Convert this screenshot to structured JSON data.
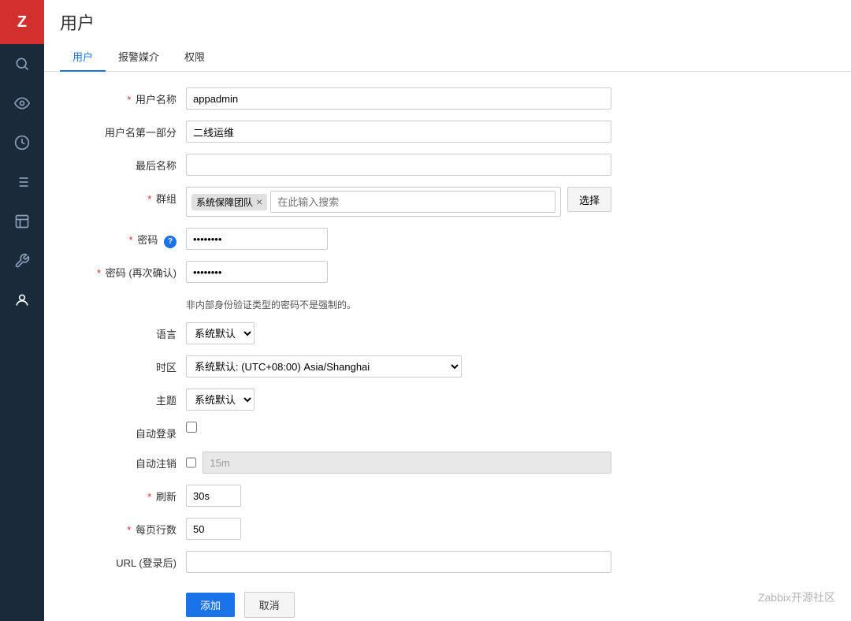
{
  "app": {
    "logo": "Z",
    "page_title": "用户"
  },
  "sidebar": {
    "items": [
      {
        "id": "search",
        "icon": "🔍"
      },
      {
        "id": "eye",
        "icon": "👁"
      },
      {
        "id": "clock",
        "icon": "⏱"
      },
      {
        "id": "list",
        "icon": "☰"
      },
      {
        "id": "chart",
        "icon": "📊"
      },
      {
        "id": "wrench",
        "icon": "🔧"
      },
      {
        "id": "gear",
        "icon": "⚙"
      }
    ]
  },
  "tabs": [
    {
      "id": "user",
      "label": "用户",
      "active": true
    },
    {
      "id": "media",
      "label": "报警媒介",
      "active": false
    },
    {
      "id": "perms",
      "label": "权限",
      "active": false
    }
  ],
  "form": {
    "username_label": "用户名称",
    "username_value": "appadmin",
    "firstname_label": "用户名第一部分",
    "firstname_value": "二线运维",
    "lastname_label": "最后名称",
    "lastname_value": "",
    "group_label": "群组",
    "group_tag": "系统保障团队",
    "group_search_placeholder": "在此输入搜索",
    "group_select_btn": "选择",
    "password_label": "密码",
    "password_value": "••••••••",
    "password_confirm_label": "密码 (再次确认)",
    "password_confirm_value": "••••••••",
    "password_note": "非内部身份验证类型的密码不是强制的。",
    "language_label": "语言",
    "language_options": [
      "系统默认"
    ],
    "language_value": "系统默认",
    "timezone_label": "时区",
    "timezone_options": [
      "系统默认: (UTC+08:00) Asia/Shanghai"
    ],
    "timezone_value": "系统默认: (UTC+08:00) Asia/Shanghai",
    "theme_label": "主题",
    "theme_options": [
      "系统默认"
    ],
    "theme_value": "系统默认",
    "autologin_label": "自动登录",
    "autologout_label": "自动注销",
    "autologout_value": "15m",
    "refresh_label": "刷新",
    "refresh_value": "30s",
    "rows_label": "每页行数",
    "rows_value": "50",
    "url_label": "URL (登录后)",
    "url_value": "",
    "add_btn": "添加",
    "cancel_btn": "取消"
  },
  "watermark": "Zabbix开源社区"
}
